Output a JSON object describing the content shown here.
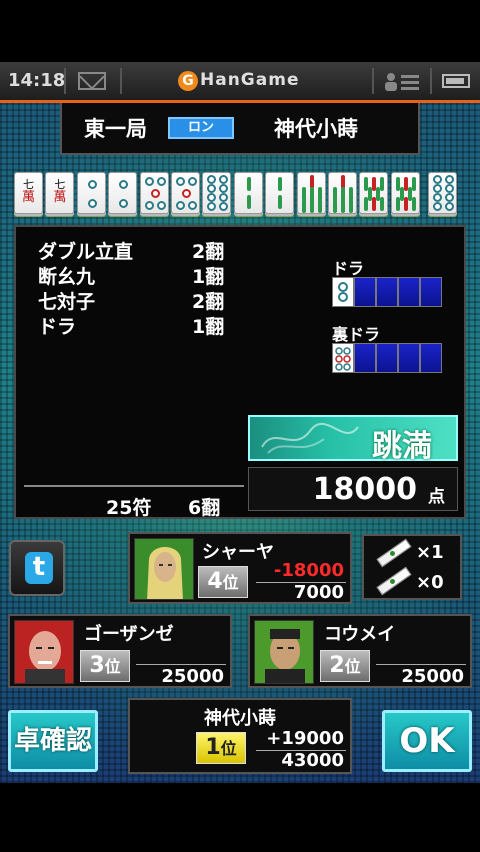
{
  "status_bar": {
    "time": "14:18",
    "brand_mark": "G",
    "brand": "HanGame",
    "icons": [
      "mail-icon",
      "people-icon",
      "battery-icon"
    ]
  },
  "header": {
    "round": "東一局",
    "win_type": "ロン",
    "winner": "神代小蒔"
  },
  "hand": {
    "tiles": [
      {
        "kind": "man",
        "label": "七",
        "sub": "萬"
      },
      {
        "kind": "man",
        "label": "七",
        "sub": "萬"
      },
      {
        "kind": "pin",
        "count": 2
      },
      {
        "kind": "pin",
        "count": 2
      },
      {
        "kind": "pin",
        "count": 5
      },
      {
        "kind": "pin",
        "count": 5
      },
      {
        "kind": "pin",
        "count": 8
      },
      {
        "kind": "sou",
        "count": 2
      },
      {
        "kind": "sou",
        "count": 2
      },
      {
        "kind": "sou",
        "count": 7
      },
      {
        "kind": "sou",
        "count": 7
      },
      {
        "kind": "sou",
        "count": 8
      },
      {
        "kind": "sou",
        "count": 8
      },
      {
        "kind": "pin",
        "count": 8
      }
    ]
  },
  "result": {
    "yaku": [
      {
        "name": "ダブル立直",
        "han": "2翻"
      },
      {
        "name": "断幺九",
        "han": "1翻"
      },
      {
        "name": "七対子",
        "han": "2翻"
      },
      {
        "name": "ドラ",
        "han": "1翻"
      }
    ],
    "dora_label": "ドラ",
    "ura_dora_label": "裏ドラ",
    "rank_name": "跳満",
    "points": "18000",
    "points_unit": "点",
    "fu": "25符",
    "han_total": "6翻"
  },
  "players": {
    "shaaya": {
      "name": "シャーヤ",
      "rank_num": "4",
      "rank_suffix": "位",
      "delta": "-18000",
      "score": "7000",
      "delta_color": "#ff2a2a"
    },
    "gozanze": {
      "name": "ゴーザンゼ",
      "rank_num": "3",
      "rank_suffix": "位",
      "score": "25000"
    },
    "koumei": {
      "name": "コウメイ",
      "rank_num": "2",
      "rank_suffix": "位",
      "score": "25000"
    },
    "winner": {
      "name": "神代小蒔",
      "rank_num": "1",
      "rank_suffix": "位",
      "delta": "+19000",
      "score": "43000"
    }
  },
  "sticks": {
    "riichi": "×1",
    "honba": "×0"
  },
  "buttons": {
    "table_check": "卓確認",
    "ok": "OK"
  }
}
